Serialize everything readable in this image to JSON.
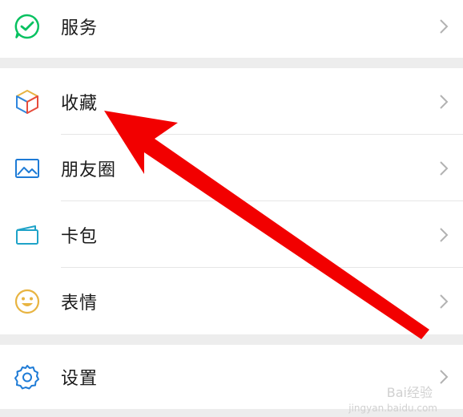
{
  "menu": {
    "services": {
      "label": "服务",
      "icon": "services-icon"
    },
    "items": [
      {
        "label": "收藏",
        "icon": "favorites-cube-icon"
      },
      {
        "label": "朋友圈",
        "icon": "moments-picture-icon"
      },
      {
        "label": "卡包",
        "icon": "card-wallet-icon"
      },
      {
        "label": "表情",
        "icon": "sticker-smiley-icon"
      }
    ],
    "settings": {
      "label": "设置",
      "icon": "settings-gear-icon"
    }
  },
  "watermark": {
    "text": "Bai经验",
    "sub": "jingyan.baidu.com"
  },
  "colors": {
    "arrow": "#f20000",
    "accent_green": "#07c160",
    "icon_blue": "#1e7bd6"
  }
}
